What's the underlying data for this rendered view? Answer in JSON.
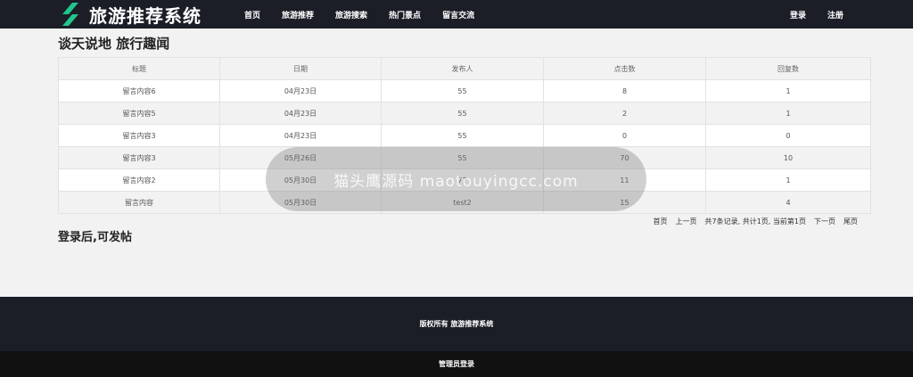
{
  "header": {
    "site_title": "旅游推荐系统",
    "nav": [
      "首页",
      "旅游推荐",
      "旅游搜索",
      "热门景点",
      "留言交流"
    ],
    "auth": {
      "login": "登录",
      "register": "注册"
    }
  },
  "main": {
    "section_title": "谈天说地 旅行趣闻",
    "table": {
      "columns": [
        "标题",
        "日期",
        "发布人",
        "点击数",
        "回复数"
      ],
      "rows": [
        [
          "留言内容6",
          "04月23日",
          "55",
          "8",
          "1"
        ],
        [
          "留言内容5",
          "04月23日",
          "55",
          "2",
          "1"
        ],
        [
          "留言内容3",
          "04月23日",
          "55",
          "0",
          "0"
        ],
        [
          "留言内容3",
          "05月26日",
          "55",
          "70",
          "10"
        ],
        [
          "留言内容2",
          "05月30日",
          "77",
          "11",
          "1"
        ],
        [
          "留言内容",
          "05月30日",
          "test2",
          "15",
          "4"
        ]
      ]
    },
    "pager": {
      "first": "首页",
      "prev": "上一页",
      "summary": "共7条记录, 共计1页, 当前第1页",
      "next": "下一页",
      "last": "尾页"
    },
    "post_hint": "登录后,可发帖"
  },
  "overlay": {
    "text": "猫头鹰源码 maotouyingcc.com"
  },
  "footer": {
    "copyright": "版权所有 旅游推荐系统",
    "admin_login": "管理员登录"
  },
  "colors": {
    "header_bg": "#1b1e27",
    "logo_green": "#21c58e",
    "footer_bottom_bg": "#111111"
  },
  "icons": {
    "logo": "green-leaf-logo-icon"
  }
}
